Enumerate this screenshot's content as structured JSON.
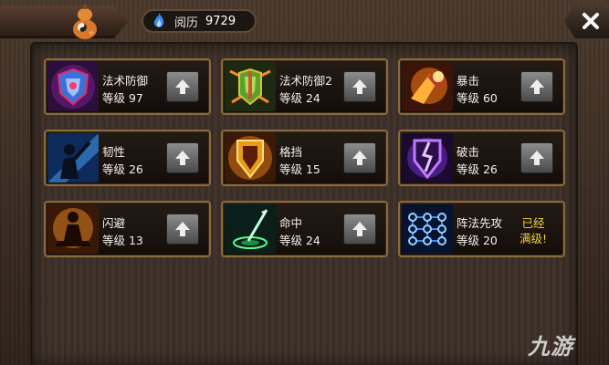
{
  "currency": {
    "label": "阅历",
    "value": "9729",
    "icon": "blue-flame-icon"
  },
  "skills": [
    {
      "name": "法术防御",
      "level": "等级 97",
      "icon": "magic-defense-armor-icon",
      "maxed": false
    },
    {
      "name": "法术防御2",
      "level": "等级 24",
      "icon": "green-armor-icon",
      "maxed": false
    },
    {
      "name": "暴击",
      "level": "等级 60",
      "icon": "fire-fist-icon",
      "maxed": false
    },
    {
      "name": "韧性",
      "level": "等级 26",
      "icon": "blue-warrior-icon",
      "maxed": false
    },
    {
      "name": "格挡",
      "level": "等级 15",
      "icon": "golden-shield-icon",
      "maxed": false
    },
    {
      "name": "破击",
      "level": "等级 26",
      "icon": "purple-broken-shield-icon",
      "maxed": false
    },
    {
      "name": "闪避",
      "level": "等级 13",
      "icon": "meditating-monk-icon",
      "maxed": false
    },
    {
      "name": "命中",
      "level": "等级 24",
      "icon": "green-arrow-icon",
      "maxed": false
    },
    {
      "name": "阵法先攻",
      "level": "等级 20",
      "icon": "formation-grid-icon",
      "maxed": true,
      "maxed_line1": "已经",
      "maxed_line2": "满级!"
    }
  ],
  "watermark": "九游",
  "colors": {
    "card_border": "#8c6a3a",
    "maxed_text": "#f2d23a"
  }
}
